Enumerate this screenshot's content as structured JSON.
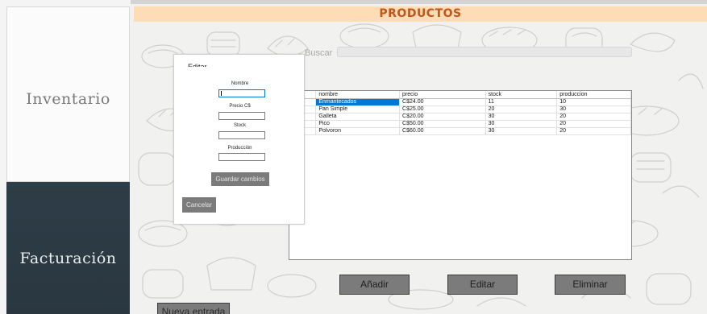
{
  "sidebar": {
    "inventory_label": "Inventario",
    "billing_label": "Facturación"
  },
  "header": {
    "title": "PRODUCTOS"
  },
  "search": {
    "label": "Buscar",
    "value": ""
  },
  "grid": {
    "columns": [
      "nombre",
      "precio",
      "stock",
      "produccion"
    ],
    "rows": [
      [
        "Enmantecados",
        "C$24.00",
        "11",
        "10"
      ],
      [
        "Pan Simple",
        "C$25.00",
        "20",
        "30"
      ],
      [
        "Galleta",
        "C$20.00",
        "30",
        "20"
      ],
      [
        "Pico",
        "C$50.00",
        "30",
        "20"
      ],
      [
        "Polvoron",
        "C$60.00",
        "30",
        "20"
      ]
    ],
    "selected_row": 0
  },
  "buttons": {
    "add": "Añadir",
    "edit": "Editar",
    "delete": "Eliminar",
    "new_entry": "Nueva entrada"
  },
  "dialog": {
    "title": "Editar",
    "fields": {
      "name_label": "Nombre",
      "price_label": "Precio C$",
      "stock_label": "Stock",
      "production_label": "Producción",
      "name_value": "",
      "price_value": "",
      "stock_value": "",
      "production_value": ""
    },
    "save_label": "Guardar cambios",
    "cancel_label": "Cancelar"
  },
  "colors": {
    "accent_title": "#c1561b",
    "title_bar_bg": "#fddcb6",
    "sidebar_dark": "#2e3d47",
    "button_gray": "#7b7b7b",
    "selection_blue": "#0078d7"
  },
  "icons": {
    "background": "bread-doodle-pattern"
  }
}
